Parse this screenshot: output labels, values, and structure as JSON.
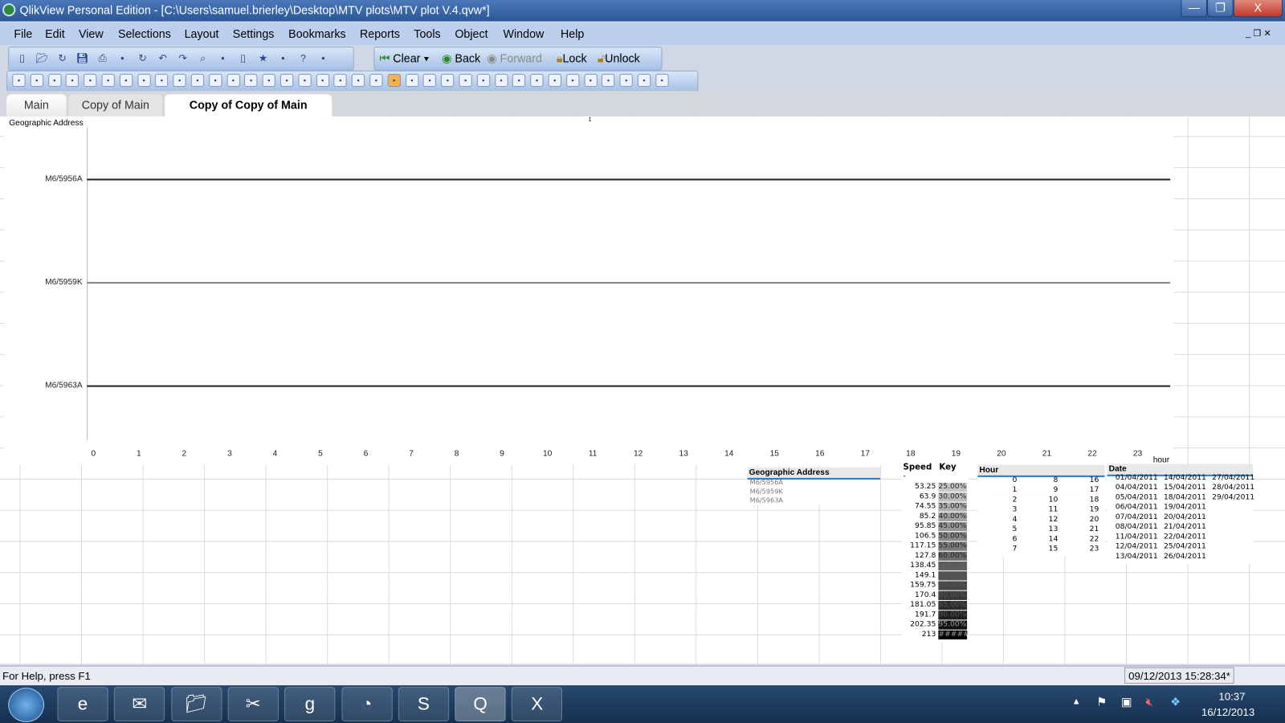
{
  "window": {
    "title": "QlikView Personal Edition - [C:\\Users\\samuel.brierley\\Desktop\\MTV plots\\MTV plot V.4.qvw*]",
    "minimize": "—",
    "restore": "❐",
    "close": "X"
  },
  "menu": [
    "File",
    "Edit",
    "View",
    "Selections",
    "Layout",
    "Settings",
    "Bookmarks",
    "Reports",
    "Tools",
    "Object",
    "Window",
    "Help"
  ],
  "toolbar1": {
    "icons": [
      "new-icon",
      "open-icon",
      "reload-icon",
      "save-icon",
      "print-icon",
      "edit-script-icon",
      "reload-data-icon",
      "undo-icon",
      "redo-icon",
      "search-icon",
      "current-selections-icon",
      "new-chart-icon",
      "bookmark-icon",
      "edit-icon",
      "help-icon",
      "context-help-icon"
    ],
    "clear": "Clear",
    "back": "Back",
    "forward": "Forward",
    "lock": "Lock",
    "unlock": "Unlock"
  },
  "toolbar2": {
    "icons": [
      "new-sheet-icon",
      "promote-sheet-icon",
      "demote-sheet-icon",
      "sheet-properties-icon",
      "listbox-icon",
      "statistics-box-icon",
      "multibox-icon",
      "table-box-icon",
      "chart-icon",
      "input-box-icon",
      "current-selections-box-icon",
      "button-icon",
      "text-object-icon",
      "line-arrow-icon",
      "slider-icon",
      "bookmark-object-icon",
      "search-object-icon",
      "container-icon",
      "custom-object-icon",
      "chart-wizard-icon",
      "format-painter-icon",
      "design-grid-icon",
      "align-left-icon",
      "center-horizontal-icon",
      "align-right-icon",
      "align-bottom-icon",
      "center-vertical-icon",
      "align-top-icon",
      "space-horizontal-icon",
      "space-vertical-icon",
      "adjust-left-icon",
      "adjust-top-icon",
      "edit-module-icon",
      "document-properties-icon",
      "sheet-props-icon",
      "expressions-icon",
      "export-icon"
    ]
  },
  "tabs": [
    "Main",
    "Copy of Main",
    "Copy of Copy of Main"
  ],
  "chart": {
    "type": "line",
    "ylabel": "Geographic Address",
    "xlabel": "hour",
    "y_categories": [
      "M6/5956A",
      "M6/5959K",
      "M6/5963A"
    ],
    "x_ticks": [
      "0",
      "1",
      "2",
      "3",
      "4",
      "5",
      "6",
      "7",
      "8",
      "9",
      "10",
      "11",
      "12",
      "13",
      "14",
      "15",
      "16",
      "17",
      "18",
      "19",
      "20",
      "21",
      "22",
      "23"
    ],
    "top_marker": "1"
  },
  "geo_listbox": {
    "title": "Geographic Address",
    "items": [
      "M6/5956A",
      "M6/5959K",
      "M6/5963A"
    ]
  },
  "speed_table": {
    "headers": [
      "Speed",
      "Key"
    ],
    "first_row": "-",
    "rows": [
      [
        "53.25",
        "25.00%"
      ],
      [
        "63.9",
        "30.00%"
      ],
      [
        "74.55",
        "35.00%"
      ],
      [
        "85.2",
        "40.00%"
      ],
      [
        "95.85",
        "45.00%"
      ],
      [
        "106.5",
        "50.00%"
      ],
      [
        "117.15",
        "55.00%"
      ],
      [
        "127.8",
        "60.00%"
      ],
      [
        "138.45",
        "65.00%"
      ],
      [
        "149.1",
        "70.00%"
      ],
      [
        "159.75",
        "75.00%"
      ],
      [
        "170.4",
        "80.00%"
      ],
      [
        "181.05",
        "85.00%"
      ],
      [
        "191.7",
        "90.00%"
      ],
      [
        "202.35",
        "95.00%"
      ],
      [
        "213",
        "#####"
      ]
    ]
  },
  "hour_listbox": {
    "title": "Hour",
    "columns": [
      [
        "0",
        "1",
        "2",
        "3",
        "4",
        "5",
        "6",
        "7"
      ],
      [
        "8",
        "9",
        "10",
        "11",
        "12",
        "13",
        "14",
        "15"
      ],
      [
        "16",
        "17",
        "18",
        "19",
        "20",
        "21",
        "22",
        "23"
      ]
    ]
  },
  "date_listbox": {
    "title": "Date",
    "columns": [
      [
        "01/04/2011",
        "04/04/2011",
        "05/04/2011",
        "06/04/2011",
        "07/04/2011",
        "08/04/2011",
        "11/04/2011",
        "12/04/2011",
        "13/04/2011"
      ],
      [
        "14/04/2011",
        "15/04/2011",
        "18/04/2011",
        "19/04/2011",
        "20/04/2011",
        "21/04/2011",
        "22/04/2011",
        "25/04/2011",
        "26/04/2011"
      ],
      [
        "27/04/2011",
        "28/04/2011",
        "29/04/2011"
      ]
    ]
  },
  "status": {
    "help": "For Help, press F1",
    "timestamp": "09/12/2013 15:28:34*"
  },
  "taskbar": {
    "apps": [
      "internet-explorer-icon",
      "outlook-icon",
      "file-explorer-icon",
      "snipping-tool-icon",
      "google-icon",
      "media-center-icon",
      "skype-icon",
      "qlikview-icon",
      "excel-icon"
    ],
    "time": "10:37",
    "date": "16/12/2013"
  }
}
